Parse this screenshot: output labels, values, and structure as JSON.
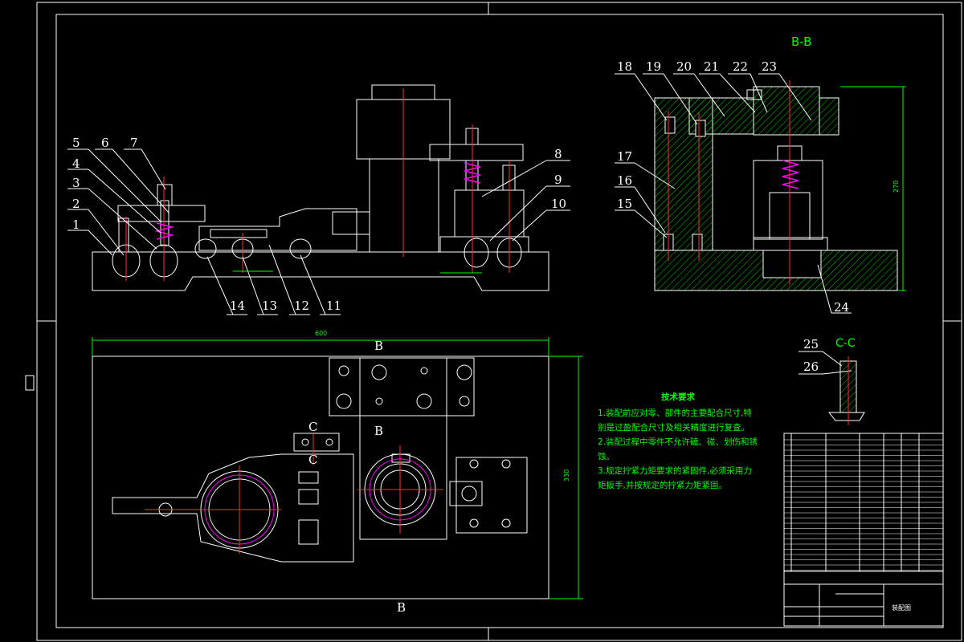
{
  "section_labels": {
    "bb": "B-B",
    "cc": "C-C"
  },
  "balloon_labels": {
    "n1": "1",
    "n2": "2",
    "n3": "3",
    "n4": "4",
    "n5": "5",
    "n6": "6",
    "n7": "7",
    "n8": "8",
    "n9": "9",
    "n10": "10",
    "n11": "11",
    "n12": "12",
    "n13": "13",
    "n14": "14",
    "n15": "15",
    "n16": "16",
    "n17": "17",
    "n18": "18",
    "n19": "19",
    "n20": "20",
    "n21": "21",
    "n22": "22",
    "n23": "23",
    "n24": "24",
    "n25": "25",
    "n26": "26"
  },
  "dimensions": {
    "overall_width": "600",
    "overall_height": "330",
    "bb_height": "270"
  },
  "view_markers": {
    "b_top": "B",
    "b_bottom": "B",
    "b_mid": "B",
    "c_top": "C",
    "c_bottom": "C"
  },
  "technical_requirements": {
    "title": "技术要求",
    "items": [
      "1.装配前应对零、部件的主要配合尺寸,特别是过盈配合尺寸及相关精度进行复查。",
      "2.装配过程中零件不允许磕、碰、划伤和锈蚀。",
      "3.规定拧紧力矩要求的紧固件,必须采用力矩扳手,并按规定的拧紧力矩紧固。"
    ]
  },
  "title_block": {
    "drawing_name": "装配图"
  },
  "colors": {
    "line": "#ffffff",
    "dim": "#00ff00",
    "center": "#ff3030",
    "hatch": "#00cc00",
    "accent": "#ff00ff"
  }
}
